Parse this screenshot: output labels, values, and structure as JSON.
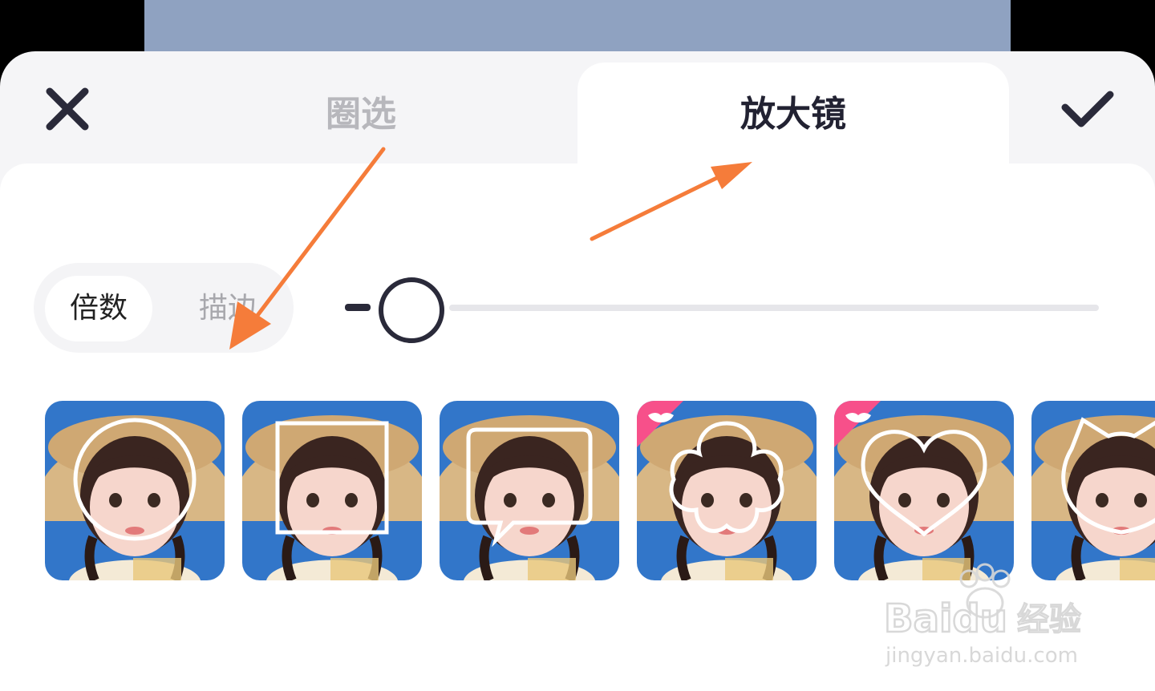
{
  "tabs": [
    {
      "label": "圈选",
      "active": false
    },
    {
      "label": "放大镜",
      "active": true
    }
  ],
  "header": {
    "close_icon": "close-icon",
    "confirm_icon": "check-icon"
  },
  "segment": {
    "multiple_label": "倍数",
    "stroke_label": "描边",
    "selected": "倍数"
  },
  "slider": {
    "value": 0,
    "minus_icon": "minus-icon"
  },
  "shapes": [
    {
      "name": "circle",
      "premium": false
    },
    {
      "name": "square",
      "premium": false
    },
    {
      "name": "speech-bubble",
      "premium": false
    },
    {
      "name": "flower",
      "premium": true
    },
    {
      "name": "heart",
      "premium": true
    },
    {
      "name": "cat-ears",
      "premium": false
    }
  ],
  "annotations": {
    "arrow_color": "#f57c3a"
  },
  "watermark": {
    "brand": "Baidu",
    "brand_cn": "经验",
    "url": "jingyan.baidu.com"
  },
  "colors": {
    "accent_dark": "#2a2a3a",
    "premium_badge": "#f7508a",
    "photo_bg": "#2f72c8"
  }
}
